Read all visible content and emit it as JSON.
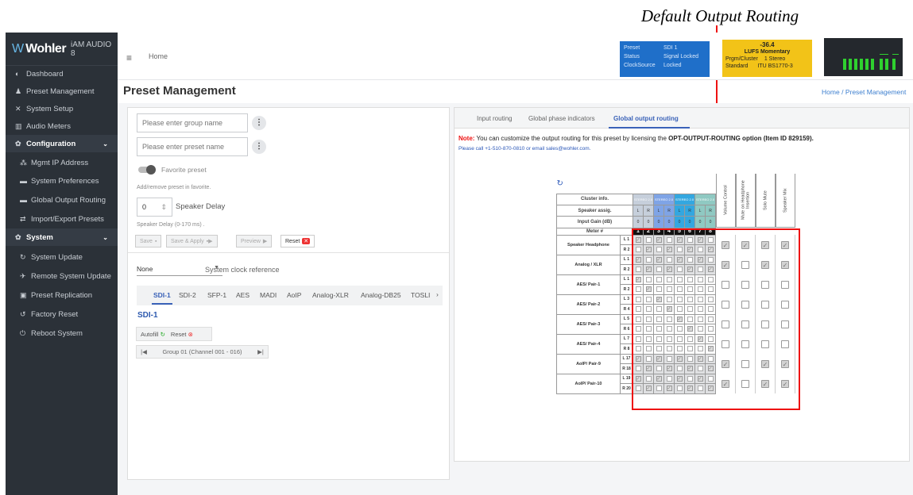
{
  "callout": "Default Output Routing",
  "app": {
    "brand": "Wohler",
    "product": "iAM AUDIO 8"
  },
  "sidebar": {
    "items": [
      {
        "label": "Dashboard",
        "icon": "dashboard-icon"
      },
      {
        "label": "Preset Management",
        "icon": "users-icon"
      },
      {
        "label": "System Setup",
        "icon": "tools-icon"
      },
      {
        "label": "Audio Meters",
        "icon": "meter-icon"
      },
      {
        "label": "Configuration",
        "icon": "gear-icon"
      },
      {
        "label": "Mgmt IP Address",
        "icon": "network-icon"
      },
      {
        "label": "System Preferences",
        "icon": "list-icon"
      },
      {
        "label": "Global Output Routing",
        "icon": "routing-icon"
      },
      {
        "label": "Import/Export Presets",
        "icon": "swap-icon"
      },
      {
        "label": "System",
        "icon": "gears-icon"
      },
      {
        "label": "System Update",
        "icon": "refresh-icon"
      },
      {
        "label": "Remote System Update",
        "icon": "satellite-icon"
      },
      {
        "label": "Preset Replication",
        "icon": "copy-icon"
      },
      {
        "label": "Factory Reset",
        "icon": "reset-icon"
      },
      {
        "label": "Reboot System",
        "icon": "power-icon"
      }
    ]
  },
  "header": {
    "home": "Home"
  },
  "status1": {
    "preset_k": "Preset",
    "preset_v": "SDI 1",
    "status_k": "Status",
    "status_v": "Signal Locked",
    "clock_k": "ClockSource",
    "clock_v": "Locked"
  },
  "status2": {
    "value": "-36.4",
    "mode": "LUFS  Momentary",
    "l1k": "Prgm/Cluster",
    "l1v": "1  Stereo",
    "l2k": "Standard",
    "l2v": "ITU BS1770-3"
  },
  "breadcrumb": {
    "home": "Home",
    "sep": "/",
    "current": "Preset Management"
  },
  "page_title": "Preset Management",
  "left": {
    "group_placeholder": "Please enter group name",
    "preset_placeholder": "Please enter preset name",
    "favorite": "Favorite preset",
    "favorite_help": "Add/remove preset in favorite.",
    "delay_value": "0",
    "delay_label": "Speaker Delay",
    "delay_help": "Speaker Delay (0-170 ms) .",
    "buttons": {
      "save": "Save",
      "save_apply": "Save & Apply",
      "preview": "Preview",
      "reset": "Reset"
    },
    "clock_value": "None",
    "clock_label": "System clock reference",
    "tabs": [
      "SDI-1",
      "SDI-2",
      "SFP-1",
      "AES",
      "MADI",
      "AoIP",
      "Analog-XLR",
      "Analog-DB25",
      "TOSLI"
    ],
    "section": "SDI-1",
    "autofill": "Autofill",
    "reset": "Reset",
    "pager": "Group 01 (Channel 001 - 016)"
  },
  "right": {
    "tabs": [
      "Input routing",
      "Global phase indicators",
      "Global output routing"
    ],
    "note_label": "Note:",
    "note_text": "You can customize the output routing for this preset by licensing the",
    "note_option": "OPT-OUTPUT-ROUTING option (Item ID 829159).",
    "note_contact": "Please call +1-510-870-0810 or email sales@wohler.com.",
    "matrix": {
      "cluster_label": "Cluster info.",
      "assign_label": "Speaker assig.",
      "gain_label": "Input Gain (dB)",
      "meter_label": "Meter #",
      "clusters": [
        "STEREO 2.0",
        "STEREO 2.0",
        "STEREO 2.0",
        "STEREO 2.0"
      ],
      "cluster_colors": [
        "#c6cfdb",
        "#7fa4e6",
        "#33a7e0",
        "#8fc9c2"
      ],
      "assign": [
        "L",
        "R",
        "L",
        "R",
        "L",
        "R",
        "L",
        "R"
      ],
      "gain": [
        "0",
        "0",
        "0",
        "0",
        "0",
        "0",
        "0",
        "0"
      ],
      "meters": [
        "1",
        "2",
        "3",
        "4",
        "5",
        "6",
        "7",
        "8"
      ],
      "out_headers": [
        "Volume Control",
        "Mute on Headphone Insertion",
        "Solo Mute",
        "Speaker Mix"
      ],
      "rows": [
        {
          "name": "Speaker Headphone",
          "ch": [
            [
              "L",
              "1"
            ],
            [
              "R",
              "2"
            ]
          ],
          "flags": [
            1,
            1,
            1,
            1
          ]
        },
        {
          "name": "Analog / XLR",
          "ch": [
            [
              "L",
              "1"
            ],
            [
              "R",
              "2"
            ]
          ],
          "flags": [
            1,
            0,
            1,
            1
          ]
        },
        {
          "name": "AES/ Pair-1",
          "ch": [
            [
              "L",
              "1"
            ],
            [
              "R",
              "2"
            ]
          ],
          "flags": [
            0,
            0,
            0,
            0
          ]
        },
        {
          "name": "AES/ Pair-2",
          "ch": [
            [
              "L",
              "3"
            ],
            [
              "R",
              "4"
            ]
          ],
          "flags": [
            0,
            0,
            0,
            0
          ]
        },
        {
          "name": "AES/ Pair-3",
          "ch": [
            [
              "L",
              "5"
            ],
            [
              "R",
              "6"
            ]
          ],
          "flags": [
            0,
            0,
            0,
            0
          ]
        },
        {
          "name": "AES/ Pair-4",
          "ch": [
            [
              "L",
              "7"
            ],
            [
              "R",
              "8"
            ]
          ],
          "flags": [
            0,
            0,
            0,
            0
          ]
        },
        {
          "name": "AoIP/ Pair-9",
          "ch": [
            [
              "L",
              "17"
            ],
            [
              "R",
              "18"
            ]
          ],
          "flags": [
            1,
            0,
            1,
            1
          ]
        },
        {
          "name": "AoIP/ Pair-10",
          "ch": [
            [
              "L",
              "19"
            ],
            [
              "R",
              "20"
            ]
          ],
          "flags": [
            1,
            0,
            1,
            1
          ]
        }
      ]
    }
  }
}
